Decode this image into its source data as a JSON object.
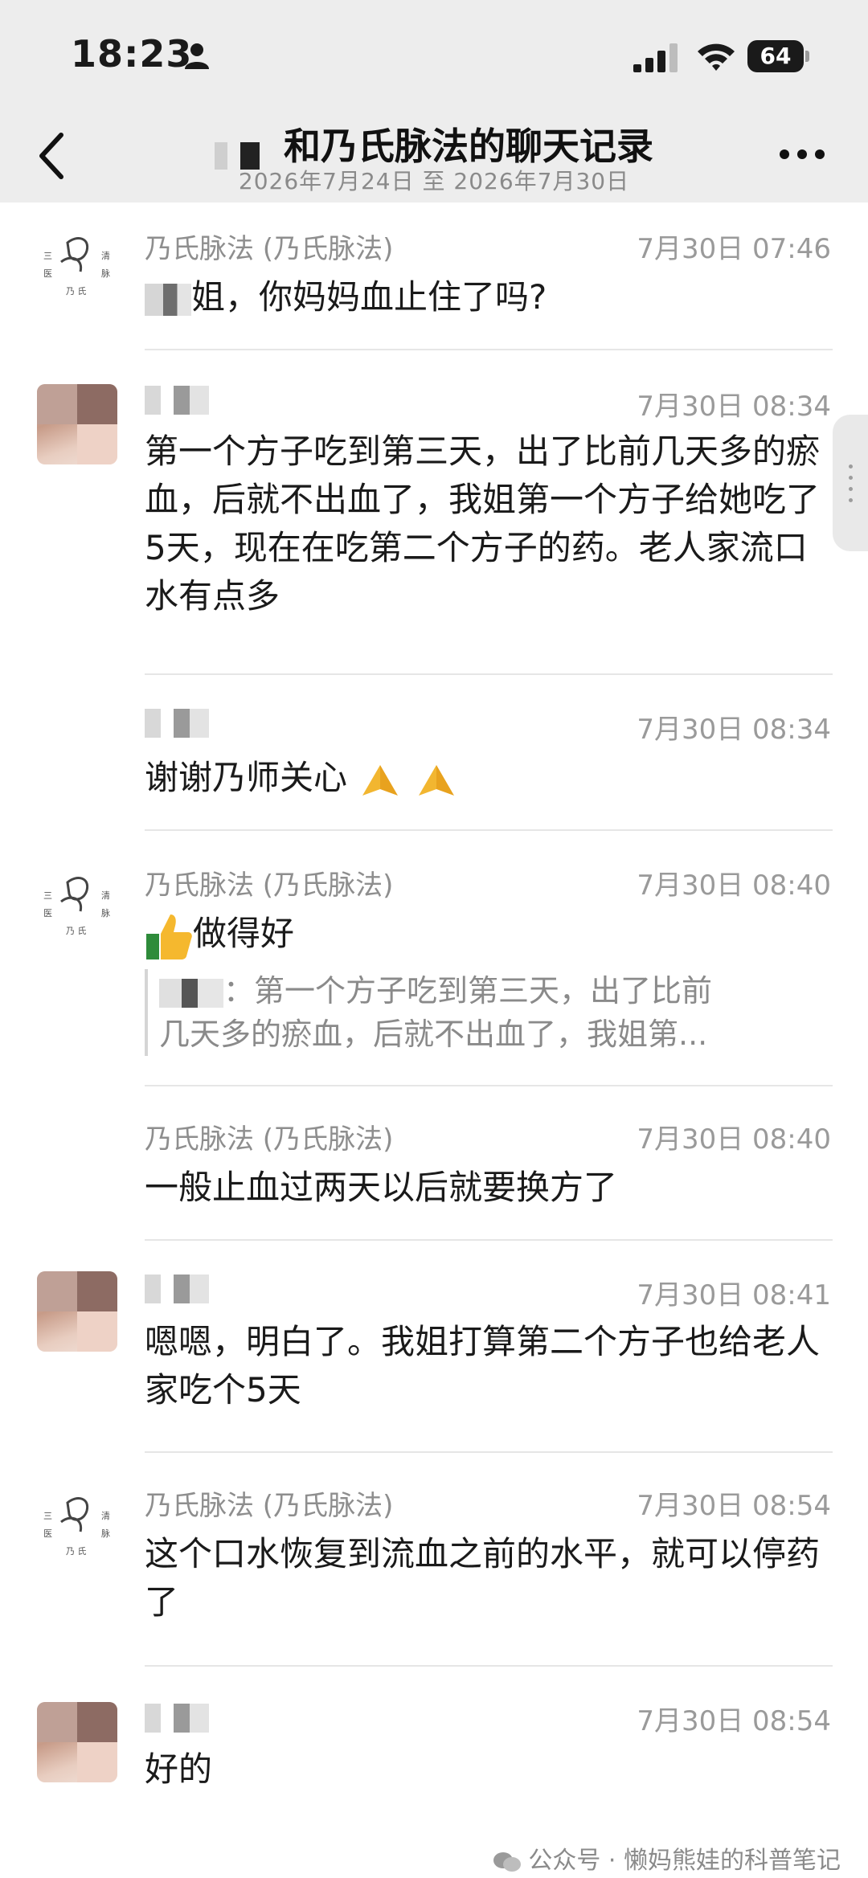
{
  "status_bar": {
    "time": "18:23",
    "battery": "64"
  },
  "header": {
    "title_suffix": "和乃氏脉法的聊天记录",
    "subtitle": "2026年7月24日 至 2026年7月30日"
  },
  "messages": [
    {
      "sender": "乃氏脉法 (乃氏脉法)",
      "time": "7月30日 07:46",
      "text_after_blur": "姐，你妈妈血止住了吗?"
    },
    {
      "time": "7月30日 08:34",
      "text": "第一个方子吃到第三天，出了比前几天多的瘀血，后就不出血了，我姐第一个方子给她吃了5天，现在在吃第二个方子的药。老人家流口水有点多"
    },
    {
      "time": "7月30日 08:34",
      "text": "谢谢乃师关心"
    },
    {
      "sender": "乃氏脉法 (乃氏脉法)",
      "time": "7月30日 08:40",
      "text": "做得好",
      "quote_line1": "：第一个方子吃到第三天，出了比前",
      "quote_line2": "几天多的瘀血，后就不出血了，我姐第..."
    },
    {
      "sender": "乃氏脉法 (乃氏脉法)",
      "time": "7月30日 08:40",
      "text": "一般止血过两天以后就要换方了"
    },
    {
      "time": "7月30日 08:41",
      "text": "嗯嗯，明白了。我姐打算第二个方子也给老人家吃个5天"
    },
    {
      "sender": "乃氏脉法 (乃氏脉法)",
      "time": "7月30日 08:54",
      "text": "这个口水恢复到流血之前的水平，就可以停药了"
    },
    {
      "time": "7月30日 08:54",
      "text": "好的"
    }
  ],
  "watermark": "公众号 · 懒妈熊娃的科普笔记",
  "colors": {
    "bar_bg": "#ededed",
    "timestamp": "#9a9a9a",
    "sender": "#8e8e8e"
  }
}
